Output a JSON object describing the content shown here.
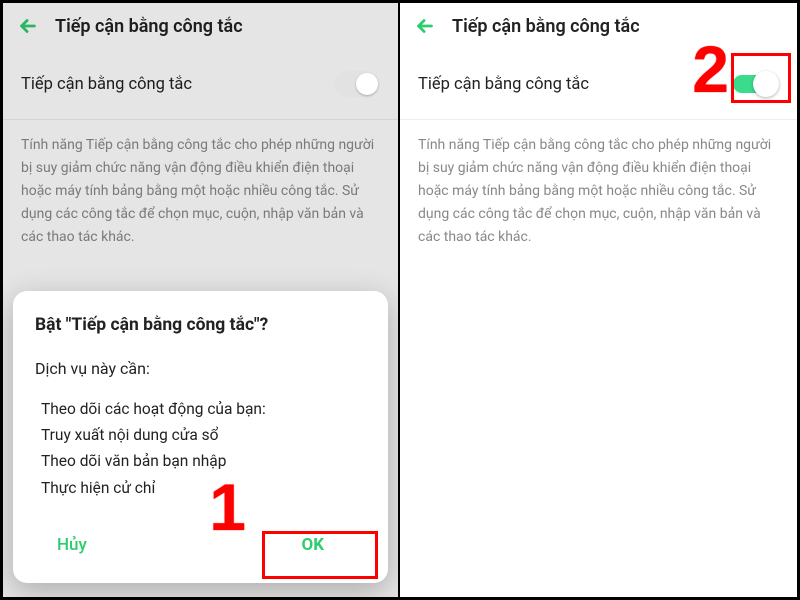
{
  "left": {
    "header_title": "Tiếp cận bằng công tắc",
    "setting_label": "Tiếp cận bằng công tắc",
    "description": "Tính năng Tiếp cận bằng công tắc cho phép những người bị suy giảm chức năng vận động điều khiển điện thoại hoặc máy tính bảng bằng một hoặc nhiều công tắc. Sử dụng các công tắc để chọn mục, cuộn, nhập văn bản và các thao tác khác.",
    "dialog": {
      "title": "Bật \"Tiếp cận bằng công tắc\"?",
      "subtitle": "Dịch vụ này cần:",
      "items": [
        "Theo dõi các hoạt động của bạn:",
        "Truy xuất nội dung cửa sổ",
        "Theo dõi văn bản bạn nhập",
        "Thực hiện cử chỉ"
      ],
      "cancel": "Hủy",
      "ok": "OK"
    }
  },
  "right": {
    "header_title": "Tiếp cận bằng công tắc",
    "setting_label": "Tiếp cận bằng công tắc",
    "description": "Tính năng Tiếp cận bằng công tắc cho phép những người bị suy giảm chức năng vận động điều khiển điện thoại hoặc máy tính bảng bằng một hoặc nhiều công tắc. Sử dụng các công tắc để chọn mục, cuộn, nhập văn bản và các thao tác khác."
  },
  "annotations": {
    "step1": "1",
    "step2": "2"
  }
}
